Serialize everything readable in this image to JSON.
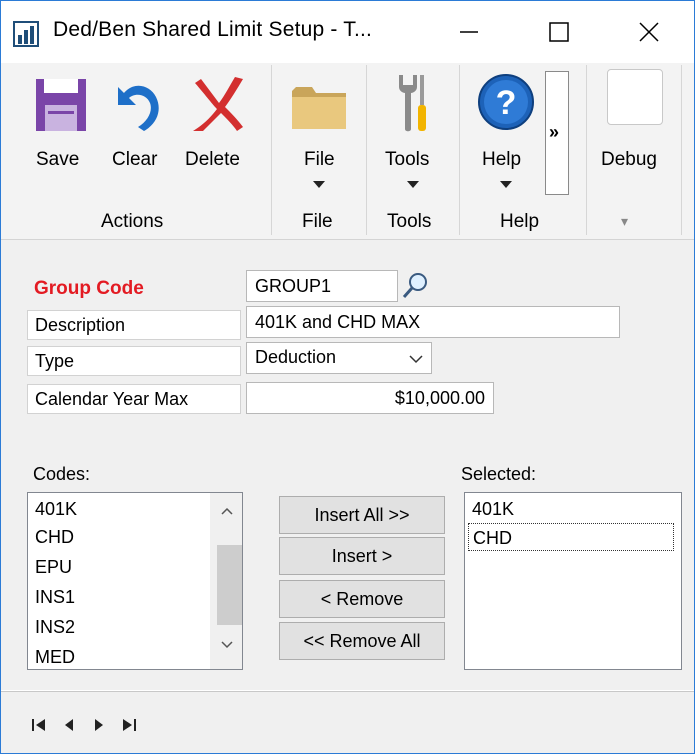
{
  "window": {
    "title": "Ded/Ben Shared Limit Setup  -  T..."
  },
  "icons": {
    "app": "chart-icon",
    "minimize": "minimize-icon",
    "maximize": "maximize-icon",
    "close": "close-icon",
    "save": "floppy-disk-icon",
    "clear": "undo-arrow-icon",
    "delete": "red-x-icon",
    "file": "folder-icon",
    "tools": "wrench-screwdriver-icon",
    "help": "help-question-icon",
    "more": "double-chevron-icon",
    "debug": "blank-icon",
    "lookup": "magnifier-icon"
  },
  "ribbon": {
    "save": "Save",
    "clear": "Clear",
    "delete": "Delete",
    "actions_group": "Actions",
    "file": "File",
    "file_group": "File",
    "tools": "Tools",
    "tools_group": "Tools",
    "help": "Help",
    "help_group": "Help",
    "more": "»",
    "debug": "Debug",
    "debug_group": "▾"
  },
  "form": {
    "group_code_label": "Group Code",
    "group_code_value": "GROUP1",
    "description_label": "Description",
    "description_value": "401K and CHD MAX",
    "type_label": "Type",
    "type_value": "Deduction",
    "cal_max_label": "Calendar Year Max",
    "cal_max_value": "$10,000.00"
  },
  "codes": {
    "label": "Codes:",
    "items": [
      "401K",
      "CHD",
      "EPU",
      "INS1",
      "INS2",
      "MED"
    ]
  },
  "selected": {
    "label": "Selected:",
    "items": [
      "401K",
      "CHD"
    ]
  },
  "buttons": {
    "insert_all": "Insert All >>",
    "insert": "Insert >",
    "remove": "< Remove",
    "remove_all": "<< Remove All"
  },
  "nav": {
    "first": "first-record-icon",
    "prev": "previous-record-icon",
    "next": "next-record-icon",
    "last": "last-record-icon"
  },
  "colors": {
    "required": "#e31b23",
    "help_blue": "#1d62b8",
    "delete_red": "#d32f2f",
    "save_purple": "#6b3fa0"
  }
}
